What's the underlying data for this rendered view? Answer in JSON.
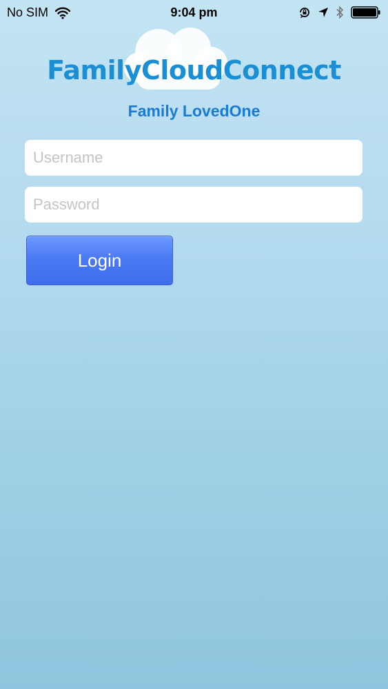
{
  "status_bar": {
    "carrier": "No SIM",
    "time": "9:04 pm",
    "icons": [
      "wifi-icon",
      "rotation-lock-icon",
      "location-arrow-icon",
      "bluetooth-icon",
      "battery-icon"
    ]
  },
  "app": {
    "logo_text": "FamilyCloudConnect",
    "subtitle": "Family LovedOne"
  },
  "form": {
    "username_placeholder": "Username",
    "password_placeholder": "Password",
    "login_label": "Login"
  },
  "colors": {
    "brand_blue": "#1b8fd6",
    "subtitle_blue": "#1a7ad8",
    "button_blue": "#4b79f2"
  }
}
